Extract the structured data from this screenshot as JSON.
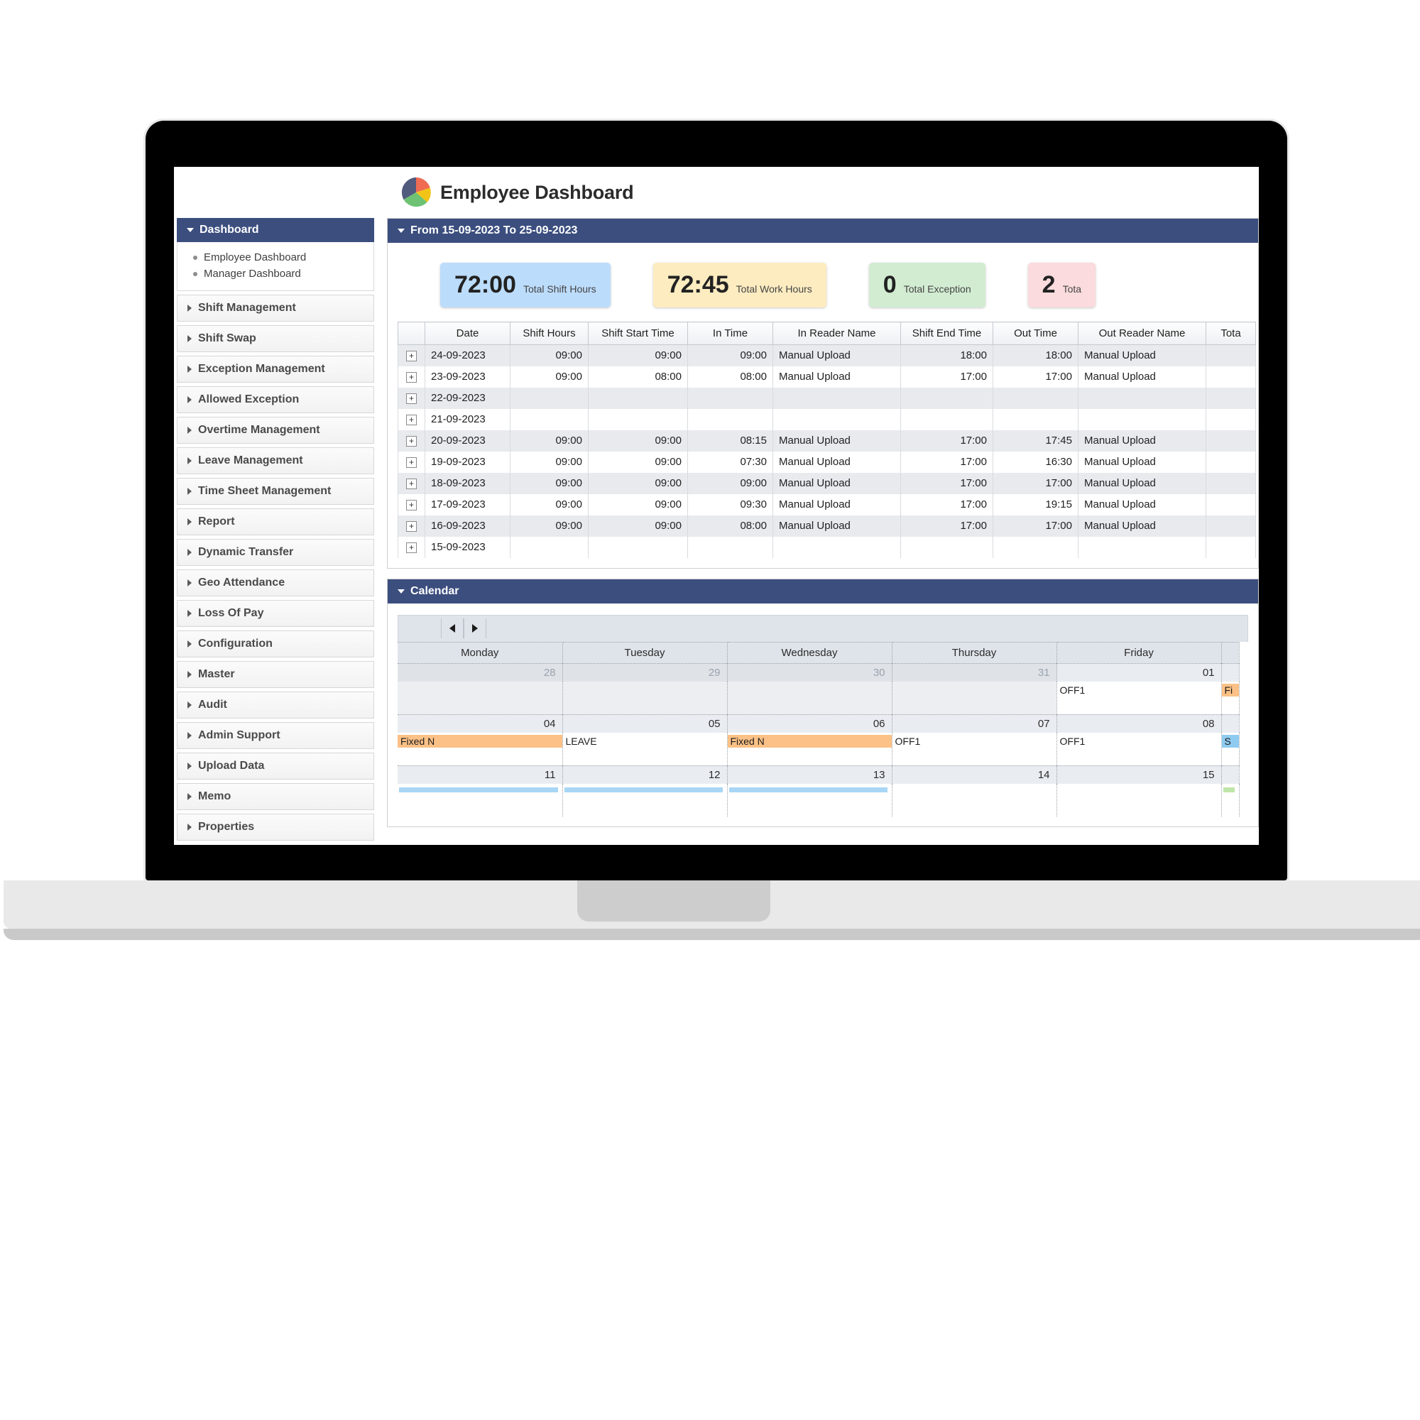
{
  "app": {
    "title": "Employee Dashboard",
    "logo_icon": "pie-chart-logo"
  },
  "sidebar": {
    "header": {
      "label": "Dashboard",
      "caret_icon": "caret-down-icon"
    },
    "sub_items": [
      {
        "label": "Employee Dashboard"
      },
      {
        "label": "Manager Dashboard"
      }
    ],
    "items": [
      {
        "label": "Shift Management"
      },
      {
        "label": "Shift Swap"
      },
      {
        "label": "Exception Management"
      },
      {
        "label": "Allowed Exception"
      },
      {
        "label": "Overtime Management"
      },
      {
        "label": "Leave Management"
      },
      {
        "label": "Time Sheet Management"
      },
      {
        "label": "Report"
      },
      {
        "label": "Dynamic Transfer"
      },
      {
        "label": "Geo Attendance"
      },
      {
        "label": "Loss Of Pay"
      },
      {
        "label": "Configuration"
      },
      {
        "label": "Master"
      },
      {
        "label": "Audit"
      },
      {
        "label": "Admin Support"
      },
      {
        "label": "Upload Data"
      },
      {
        "label": "Memo"
      },
      {
        "label": "Properties"
      }
    ]
  },
  "range_panel": {
    "title": "From 15-09-2023 To 25-09-2023",
    "caret_icon": "caret-down-icon"
  },
  "kpis": [
    {
      "value": "72:00",
      "label": "Total Shift Hours",
      "bg": "#bcdcfb",
      "name": "total-shift-hours"
    },
    {
      "value": "72:45",
      "label": "Total Work Hours",
      "bg": "#fdecc0",
      "name": "total-work-hours"
    },
    {
      "value": "0",
      "label": "Total Exception",
      "bg": "#d2ecd2",
      "name": "total-exception"
    },
    {
      "value": "2",
      "label": "Tota",
      "bg": "#fbdbdd",
      "name": "total-clipped"
    }
  ],
  "table": {
    "columns": [
      "",
      "Date",
      "Shift Hours",
      "Shift Start Time",
      "In Time",
      "In Reader Name",
      "Shift End Time",
      "Out Time",
      "Out Reader Name",
      "Tota"
    ],
    "expand_icon": "plus-box-icon",
    "rows": [
      {
        "date": "24-09-2023",
        "shift_hours": "09:00",
        "shift_start": "09:00",
        "in_time": "09:00",
        "in_reader": "Manual Upload",
        "shift_end": "18:00",
        "out_time": "18:00",
        "out_reader": "Manual Upload",
        "total": ""
      },
      {
        "date": "23-09-2023",
        "shift_hours": "09:00",
        "shift_start": "08:00",
        "in_time": "08:00",
        "in_reader": "Manual Upload",
        "shift_end": "17:00",
        "out_time": "17:00",
        "out_reader": "Manual Upload",
        "total": ""
      },
      {
        "date": "22-09-2023",
        "shift_hours": "",
        "shift_start": "",
        "in_time": "",
        "in_reader": "",
        "shift_end": "",
        "out_time": "",
        "out_reader": "",
        "total": ""
      },
      {
        "date": "21-09-2023",
        "shift_hours": "",
        "shift_start": "",
        "in_time": "",
        "in_reader": "",
        "shift_end": "",
        "out_time": "",
        "out_reader": "",
        "total": ""
      },
      {
        "date": "20-09-2023",
        "shift_hours": "09:00",
        "shift_start": "09:00",
        "in_time": "08:15",
        "in_reader": "Manual Upload",
        "shift_end": "17:00",
        "out_time": "17:45",
        "out_reader": "Manual Upload",
        "total": ""
      },
      {
        "date": "19-09-2023",
        "shift_hours": "09:00",
        "shift_start": "09:00",
        "in_time": "07:30",
        "in_reader": "Manual Upload",
        "shift_end": "17:00",
        "out_time": "16:30",
        "out_reader": "Manual Upload",
        "total": ""
      },
      {
        "date": "18-09-2023",
        "shift_hours": "09:00",
        "shift_start": "09:00",
        "in_time": "09:00",
        "in_reader": "Manual Upload",
        "shift_end": "17:00",
        "out_time": "17:00",
        "out_reader": "Manual Upload",
        "total": ""
      },
      {
        "date": "17-09-2023",
        "shift_hours": "09:00",
        "shift_start": "09:00",
        "in_time": "09:30",
        "in_reader": "Manual Upload",
        "shift_end": "17:00",
        "out_time": "19:15",
        "out_reader": "Manual Upload",
        "total": ""
      },
      {
        "date": "16-09-2023",
        "shift_hours": "09:00",
        "shift_start": "09:00",
        "in_time": "08:00",
        "in_reader": "Manual Upload",
        "shift_end": "17:00",
        "out_time": "17:00",
        "out_reader": "Manual Upload",
        "total": ""
      },
      {
        "date": "15-09-2023",
        "shift_hours": "",
        "shift_start": "",
        "in_time": "",
        "in_reader": "",
        "shift_end": "",
        "out_time": "",
        "out_reader": "",
        "total": ""
      }
    ]
  },
  "calendar": {
    "title": "Calendar",
    "caret_icon": "caret-down-icon",
    "prev_icon": "triangle-left-icon",
    "next_icon": "triangle-right-icon",
    "day_headers": [
      "Monday",
      "Tuesday",
      "Wednesday",
      "Thursday",
      "Friday",
      ""
    ],
    "weeks": [
      {
        "dates": [
          {
            "num": "28",
            "other": true
          },
          {
            "num": "29",
            "other": true
          },
          {
            "num": "30",
            "other": true
          },
          {
            "num": "31",
            "other": true
          },
          {
            "num": "01",
            "other": false
          },
          {
            "num": "",
            "other": false
          }
        ],
        "events": [
          {
            "text": "",
            "style": "plain",
            "other": true
          },
          {
            "text": "",
            "style": "plain",
            "other": true
          },
          {
            "text": "",
            "style": "plain",
            "other": true
          },
          {
            "text": "",
            "style": "plain",
            "other": true
          },
          {
            "text": "OFF1",
            "style": "plain",
            "other": false
          },
          {
            "text": "Fi",
            "style": "orange",
            "other": false
          }
        ]
      },
      {
        "dates": [
          {
            "num": "04",
            "other": false
          },
          {
            "num": "05",
            "other": false
          },
          {
            "num": "06",
            "other": false
          },
          {
            "num": "07",
            "other": false
          },
          {
            "num": "08",
            "other": false
          },
          {
            "num": "",
            "other": false
          }
        ],
        "events": [
          {
            "text": "Fixed  N",
            "style": "orange",
            "other": false
          },
          {
            "text": "LEAVE",
            "style": "plain",
            "other": false
          },
          {
            "text": "Fixed  N",
            "style": "orange",
            "other": false
          },
          {
            "text": "OFF1",
            "style": "plain",
            "other": false
          },
          {
            "text": "OFF1",
            "style": "plain",
            "other": false
          },
          {
            "text": "S",
            "style": "blue",
            "other": false
          }
        ]
      },
      {
        "dates": [
          {
            "num": "11",
            "other": false
          },
          {
            "num": "12",
            "other": false
          },
          {
            "num": "13",
            "other": false
          },
          {
            "num": "14",
            "other": false
          },
          {
            "num": "15",
            "other": false
          },
          {
            "num": "",
            "other": false
          }
        ],
        "events": [
          {
            "text": "",
            "style": "bar-blue",
            "other": false
          },
          {
            "text": "",
            "style": "bar-blue",
            "other": false
          },
          {
            "text": "",
            "style": "bar-blue",
            "other": false
          },
          {
            "text": "",
            "style": "plain",
            "other": false
          },
          {
            "text": "",
            "style": "plain",
            "other": false
          },
          {
            "text": "",
            "style": "bar-green",
            "other": false
          }
        ]
      }
    ]
  }
}
